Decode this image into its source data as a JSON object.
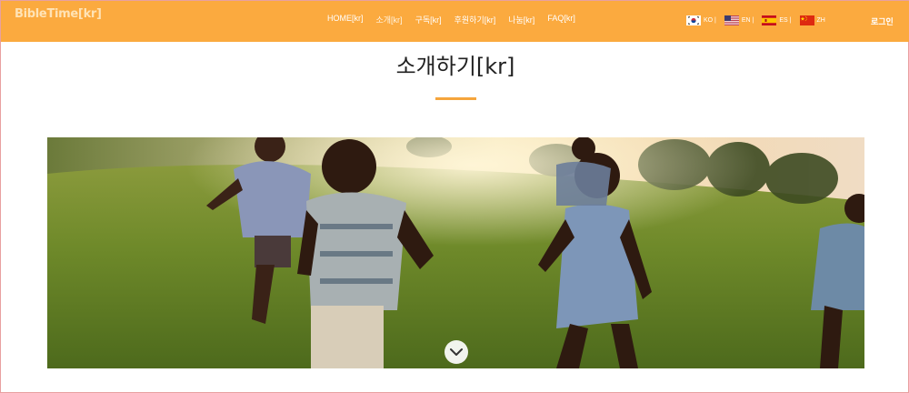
{
  "header": {
    "brand": "BibleTime[kr]",
    "nav": [
      {
        "label": "HOME[kr]"
      },
      {
        "label": "소개[kr]"
      },
      {
        "label": "구독[kr]"
      },
      {
        "label": "후원하기[kr]"
      },
      {
        "label": "나눔[kr]"
      },
      {
        "label": "FAQ[kr]"
      }
    ],
    "languages": [
      {
        "code": "KO |",
        "flag": "korea-flag-icon"
      },
      {
        "code": "EN |",
        "flag": "usa-flag-icon"
      },
      {
        "code": "ES |",
        "flag": "spain-flag-icon"
      },
      {
        "code": "ZH",
        "flag": "china-flag-icon"
      }
    ],
    "login": "로그인"
  },
  "main": {
    "title": "소개하기[kr]",
    "hero_icon": "chevron-down-icon"
  },
  "colors": {
    "header_bg": "#fbaa3f",
    "accent": "#f5a53c"
  }
}
